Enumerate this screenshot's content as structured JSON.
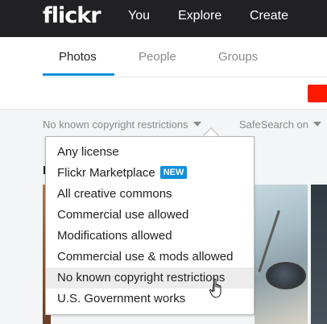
{
  "app": {
    "logo": "flickr"
  },
  "topnav": {
    "items": [
      "You",
      "Explore",
      "Create"
    ]
  },
  "tabs": [
    {
      "label": "Photos",
      "active": true
    },
    {
      "label": "People",
      "active": false
    },
    {
      "label": "Groups",
      "active": false
    }
  ],
  "filters": {
    "license": "No known copyright restrictions",
    "safesearch": "SafeSearch on"
  },
  "section": {
    "partial_heading": "I"
  },
  "license_menu": {
    "items": [
      {
        "label": "Any license"
      },
      {
        "label": "Flickr Marketplace",
        "badge": "NEW"
      },
      {
        "label": "All creative commons"
      },
      {
        "label": "Commercial use allowed"
      },
      {
        "label": "Modifications allowed"
      },
      {
        "label": "Commercial use & mods allowed"
      },
      {
        "label": "No known copyright restrictions",
        "selected": true
      },
      {
        "label": "U.S. Government works"
      }
    ]
  },
  "colors": {
    "topbar": "#212124",
    "accent": "#128fdc",
    "brand_red": "#ff1a00",
    "menu_highlight": "#ececec"
  },
  "icons": {
    "cursor": "hand-pointer-icon",
    "caret": "caret-down-icon"
  }
}
